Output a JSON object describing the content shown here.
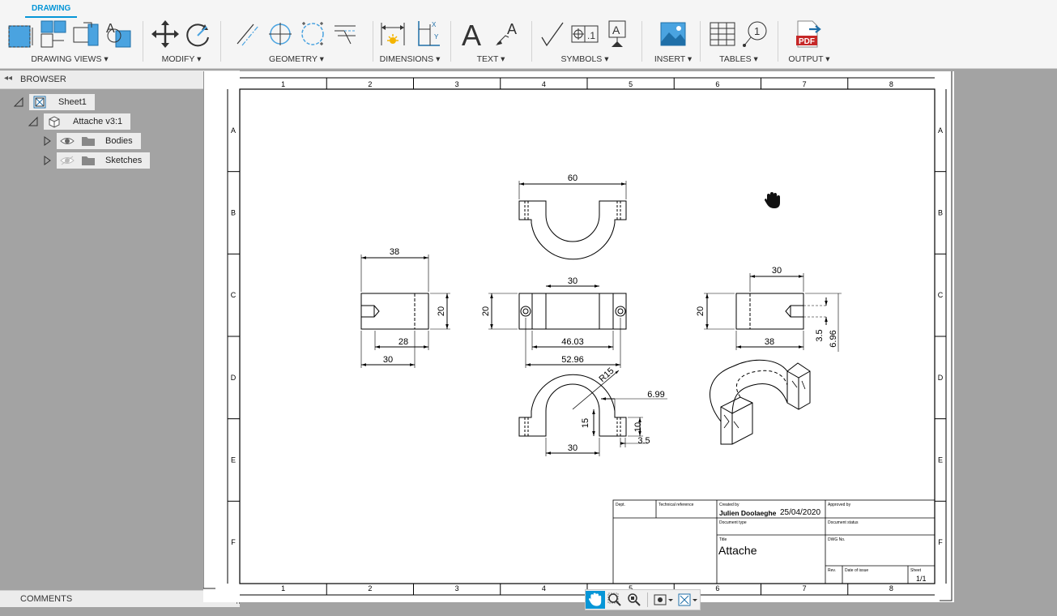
{
  "ribbon": {
    "active_tab": "DRAWING",
    "groups": [
      {
        "label": "DRAWING VIEWS ▾",
        "icons": [
          "base-view-icon",
          "projected-view-icon",
          "section-view-icon",
          "detail-view-icon"
        ]
      },
      {
        "label": "MODIFY ▾",
        "icons": [
          "move-icon",
          "rotate-icon"
        ]
      },
      {
        "label": "GEOMETRY ▾",
        "icons": [
          "centerline-icon",
          "center-mark-icon",
          "center-mark-pattern-icon",
          "edge-extension-icon"
        ]
      },
      {
        "label": "DIMENSIONS ▾",
        "icons": [
          "dimension-icon",
          "ordinate-dimension-icon"
        ]
      },
      {
        "label": "TEXT ▾",
        "icons": [
          "text-icon",
          "leader-text-icon"
        ]
      },
      {
        "label": "SYMBOLS ▾",
        "icons": [
          "surface-texture-icon",
          "feature-control-frame-icon",
          "datum-identifier-icon"
        ]
      },
      {
        "label": "INSERT ▾",
        "icons": [
          "insert-image-icon"
        ]
      },
      {
        "label": "TABLES ▾",
        "icons": [
          "table-icon",
          "balloon-icon"
        ]
      },
      {
        "label": "OUTPUT ▾",
        "icons": [
          "pdf-output-icon"
        ]
      }
    ]
  },
  "browser": {
    "title": "BROWSER",
    "sheet": "Sheet1",
    "component": "Attache v3:1",
    "folders": [
      "Bodies",
      "Sketches"
    ]
  },
  "comments": {
    "title": "COMMENTS"
  },
  "border": {
    "columns": [
      "1",
      "2",
      "3",
      "4",
      "5",
      "6",
      "7",
      "8"
    ],
    "rows": [
      "A",
      "B",
      "C",
      "D",
      "E",
      "F"
    ]
  },
  "dimensions": {
    "top_width": "60",
    "left_width": "38",
    "left_height": "20",
    "left_inner": "28",
    "left_bottom": "30",
    "front_top": "30",
    "front_height": "20",
    "front_hole_spacing": "46.03",
    "front_overall": "52.96",
    "right_top": "30",
    "right_height": "20",
    "right_bottom": "38",
    "right_hole": "3.5",
    "right_depth": "6.96",
    "bottom_radius": "R15",
    "bottom_slot": "6.99",
    "bottom_height": "15",
    "bottom_slot_height": "10",
    "bottom_offset": "3.5",
    "bottom_width": "30"
  },
  "title_block": {
    "dept_label": "Dept.",
    "tech_ref_label": "Technical reference",
    "created_by_label": "Created by",
    "author": "Julien Doolaeghe",
    "date": "25/04/2020",
    "approved_by_label": "Approved by",
    "doc_type_label": "Document type",
    "doc_status_label": "Document status",
    "title_label": "Title",
    "title": "Attache",
    "dwg_no_label": "DWG No.",
    "rev_label": "Rev.",
    "date_issue_label": "Date of issue",
    "sheet_label": "Sheet",
    "sheet_value": "1/1"
  },
  "nav_bar": {
    "icons": [
      "pan-icon",
      "zoom-window-icon",
      "zoom-fit-icon",
      "display-settings-icon",
      "sheet-settings-icon"
    ]
  },
  "colors": {
    "accent": "#0696d7",
    "background": "#a3a3a3",
    "sheet": "#ffffff"
  }
}
